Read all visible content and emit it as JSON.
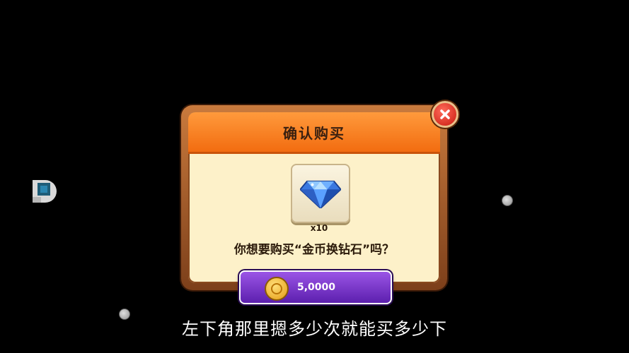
{
  "dialog": {
    "title": "确认购买",
    "item": {
      "icon": "diamond-icon",
      "quantity": "x10"
    },
    "question": "你想要购买“金币换钻石”吗？",
    "price": {
      "icon": "gold-coin-icon",
      "amount": "5,0000"
    },
    "close_icon": "close-icon"
  },
  "subtitle": "左下角那里摁多少次就能买多少下",
  "colors": {
    "header": "#f26c10",
    "panel": "#fdf1c9",
    "frame": "#a85a28",
    "price_button": "#6a2bc2",
    "close_button": "#d9261a"
  }
}
